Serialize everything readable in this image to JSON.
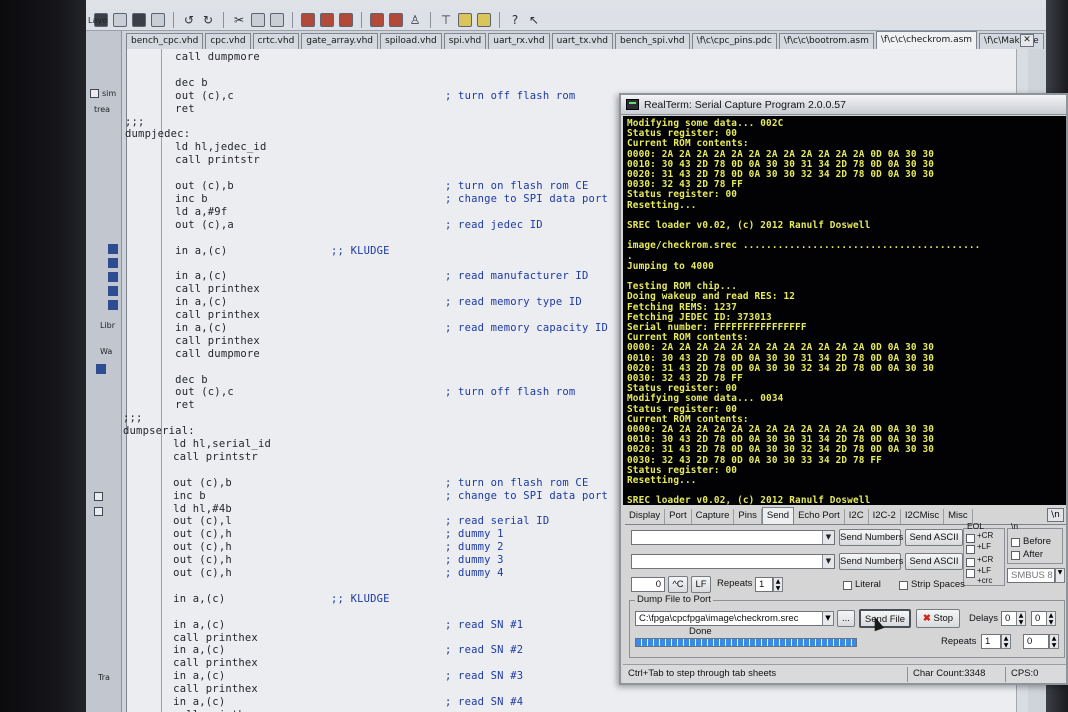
{
  "ide": {
    "tabs": [
      "bench_cpc.vhd",
      "cpc.vhd",
      "crtc.vhd",
      "gate_array.vhd",
      "spiload.vhd",
      "spi.vhd",
      "uart_rx.vhd",
      "uart_tx.vhd",
      "bench_spi.vhd",
      "\\f\\c\\cpc_pins.pdc",
      "\\f\\c\\c\\bootrom.asm",
      "\\f\\c\\c\\checkrom.asm",
      "\\f\\c\\Makefile"
    ],
    "active_tab": 11,
    "left_panel": [
      "Layo",
      "sim",
      "trea",
      "Libr",
      "Wa",
      "Tra"
    ],
    "code": [
      {
        "t": "        call dumpmore",
        "c": ""
      },
      {
        "t": "",
        "c": ""
      },
      {
        "t": "        dec b",
        "c": ""
      },
      {
        "t": "        out (c),c",
        "c": "; turn off flash rom"
      },
      {
        "t": "        ret",
        "c": ""
      },
      {
        "t": ";;;",
        "c": ""
      },
      {
        "t": "dumpjedec:",
        "c": ""
      },
      {
        "t": "        ld hl,jedec_id",
        "c": ""
      },
      {
        "t": "        call printstr",
        "c": ""
      },
      {
        "t": "",
        "c": ""
      },
      {
        "t": "        out (c),b",
        "c": "; turn on flash rom CE"
      },
      {
        "t": "        inc b",
        "c": "; change to SPI data port"
      },
      {
        "t": "        ld a,#9f",
        "c": ""
      },
      {
        "t": "        out (c),a",
        "c": "; read jedec ID"
      },
      {
        "t": "",
        "c": ""
      },
      {
        "t": "        in a,(c)",
        "c": ";; KLUDGE",
        "k": true
      },
      {
        "t": "",
        "c": ""
      },
      {
        "t": "        in a,(c)",
        "c": "; read manufacturer ID"
      },
      {
        "t": "        call printhex",
        "c": ""
      },
      {
        "t": "        in a,(c)",
        "c": "; read memory type ID"
      },
      {
        "t": "        call printhex",
        "c": ""
      },
      {
        "t": "        in a,(c)",
        "c": "; read memory capacity ID"
      },
      {
        "t": "        call printhex",
        "c": ""
      },
      {
        "t": "        call dumpmore",
        "c": ""
      },
      {
        "t": "",
        "c": ""
      },
      {
        "t": "        dec b",
        "c": ""
      },
      {
        "t": "        out (c),c",
        "c": "; turn off flash rom"
      },
      {
        "t": "        ret",
        "c": ""
      },
      {
        "t": ";;;",
        "c": ""
      },
      {
        "t": "dumpserial:",
        "c": ""
      },
      {
        "t": "        ld hl,serial_id",
        "c": ""
      },
      {
        "t": "        call printstr",
        "c": ""
      },
      {
        "t": "",
        "c": ""
      },
      {
        "t": "        out (c),b",
        "c": "; turn on flash rom CE"
      },
      {
        "t": "        inc b",
        "c": "; change to SPI data port"
      },
      {
        "t": "        ld hl,#4b",
        "c": ""
      },
      {
        "t": "        out (c),l",
        "c": "; read serial ID"
      },
      {
        "t": "        out (c),h",
        "c": "; dummy 1"
      },
      {
        "t": "        out (c),h",
        "c": "; dummy 2"
      },
      {
        "t": "        out (c),h",
        "c": "; dummy 3"
      },
      {
        "t": "        out (c),h",
        "c": "; dummy 4"
      },
      {
        "t": "",
        "c": ""
      },
      {
        "t": "        in a,(c)",
        "c": ";; KLUDGE",
        "k": true
      },
      {
        "t": "",
        "c": ""
      },
      {
        "t": "        in a,(c)",
        "c": "; read SN #1"
      },
      {
        "t": "        call printhex",
        "c": ""
      },
      {
        "t": "        in a,(c)",
        "c": "; read SN #2"
      },
      {
        "t": "        call printhex",
        "c": ""
      },
      {
        "t": "        in a,(c)",
        "c": "; read SN #3"
      },
      {
        "t": "        call printhex",
        "c": ""
      },
      {
        "t": "        in a,(c)",
        "c": "; read SN #4"
      },
      {
        "t": "        call printhex",
        "c": ""
      }
    ]
  },
  "realterm": {
    "title": "RealTerm: Serial Capture Program 2.0.0.57",
    "terminal": [
      "Modifying some data... 002C",
      "Status register: 00",
      "Current ROM contents:",
      "0000: 2A 2A 2A 2A 2A 2A 2A 2A 2A 2A 2A 2A 0D 0A 30 30",
      "0010: 30 43 2D 78 0D 0A 30 30 31 34 2D 78 0D 0A 30 30",
      "0020: 31 43 2D 78 0D 0A 30 30 32 34 2D 78 0D 0A 30 30",
      "0030: 32 43 2D 78 FF",
      "Status register: 00",
      "Resetting...",
      "",
      "SREC loader v0.02, (c) 2012 Ranulf Doswell",
      "",
      "image/checkrom.srec .........................................",
      ".",
      "Jumping to 4000",
      "",
      "Testing ROM chip...",
      "Doing wakeup and read RES: 12",
      "Fetching REMS: 1237",
      "Fetching JEDEC ID: 373013",
      "Serial number: FFFFFFFFFFFFFFFF",
      "Current ROM contents:",
      "0000: 2A 2A 2A 2A 2A 2A 2A 2A 2A 2A 2A 2A 0D 0A 30 30",
      "0010: 30 43 2D 78 0D 0A 30 30 31 34 2D 78 0D 0A 30 30",
      "0020: 31 43 2D 78 0D 0A 30 30 32 34 2D 78 0D 0A 30 30",
      "0030: 32 43 2D 78 FF",
      "Status register: 00",
      "Modifying some data... 0034",
      "Status register: 00",
      "Current ROM contents:",
      "0000: 2A 2A 2A 2A 2A 2A 2A 2A 2A 2A 2A 2A 0D 0A 30 30",
      "0010: 30 43 2D 78 0D 0A 30 30 31 34 2D 78 0D 0A 30 30",
      "0020: 31 43 2D 78 0D 0A 30 30 32 34 2D 78 0D 0A 30 30",
      "0030: 32 43 2D 78 0D 0A 30 30 33 34 2D 78 FF",
      "Status register: 00",
      "Resetting...",
      "",
      "SREC loader v0.02, (c) 2012 Ranulf Doswell"
    ],
    "tabs": [
      "Display",
      "Port",
      "Capture",
      "Pins",
      "Send",
      "Echo Port",
      "I2C",
      "I2C-2",
      "I2CMisc",
      "Misc"
    ],
    "active_tab": 4,
    "tab_right": "\\n",
    "send": {
      "send_numbers": "Send Numbers",
      "send_ascii": "Send ASCII",
      "eol_label": "EOL",
      "eol_cr": "+CR",
      "eol_lf": "+LF",
      "eol_crc": "+crc",
      "newline_label": "\\n",
      "before": "Before",
      "after": "After",
      "zero_value": "0",
      "c_btn": "^C",
      "lf_btn": "LF",
      "repeats_label": "Repeats",
      "repeats_value": "1",
      "literal": "Literal",
      "strip_spaces": "Strip Spaces",
      "smbus": "SMBUS 8"
    },
    "dump": {
      "group_label": "Dump File to Port",
      "file_path": "C:\\fpga\\cpcfpga\\image\\checkrom.srec",
      "browse": "...",
      "send_file": "Send File",
      "stop": "Stop",
      "delays_label": "Delays",
      "delay1": "0",
      "delay2": "0",
      "status": "Done",
      "progress": 1.0,
      "repeats_label": "Repeats",
      "repeats_value": "1",
      "repeats_value2": "0"
    },
    "status_bar": {
      "hint": "Ctrl+Tab to step through tab sheets",
      "char_count": "Char Count:3348",
      "cps": "CPS:0"
    },
    "colors": {
      "terminal_bg": "#020205",
      "terminal_fg": "#e6e95c",
      "comment": "#1d3aa6"
    }
  }
}
